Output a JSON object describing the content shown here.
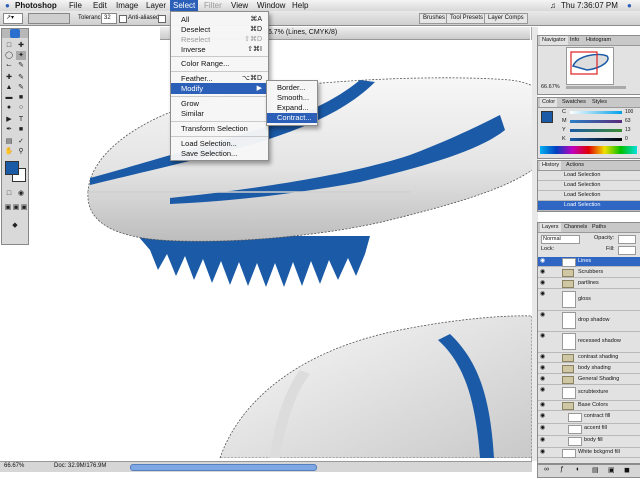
{
  "menubar": {
    "items": [
      "Photoshop",
      "File",
      "Edit",
      "Image",
      "Layer",
      "Select",
      "Filter",
      "View",
      "Window",
      "Help"
    ],
    "clock": "Thu 7:36:07 PM"
  },
  "options_bar": {
    "tolerance_label": "Tolerance:",
    "tolerance_value": "32",
    "anti_aliased_label": "Anti-aliased",
    "palette_tabs": [
      "Brushes",
      "Tool Presets",
      "Layer Comps"
    ]
  },
  "document": {
    "title": "@ 66.7% (Lines, CMYK/8)",
    "zoom": "66.67%",
    "doc_size": "Doc: 32.9M/176.9M"
  },
  "select_menu": {
    "items": [
      {
        "label": "All",
        "shortcut": "⌘A",
        "disabled": false
      },
      {
        "label": "Deselect",
        "shortcut": "⌘D",
        "disabled": false
      },
      {
        "label": "Reselect",
        "shortcut": "⇧⌘D",
        "disabled": true
      },
      {
        "label": "Inverse",
        "shortcut": "⇧⌘I",
        "disabled": false
      },
      {
        "label": "Color Range...",
        "shortcut": "",
        "disabled": false
      },
      {
        "label": "Feather...",
        "shortcut": "⌥⌘D",
        "disabled": false
      },
      {
        "label": "Modify",
        "shortcut": "▶",
        "disabled": false
      },
      {
        "label": "Grow",
        "shortcut": "",
        "disabled": false
      },
      {
        "label": "Similar",
        "shortcut": "",
        "disabled": false
      },
      {
        "label": "Transform Selection",
        "shortcut": "",
        "disabled": false
      },
      {
        "label": "Load Selection...",
        "shortcut": "",
        "disabled": false
      },
      {
        "label": "Save Selection...",
        "shortcut": "",
        "disabled": false
      }
    ],
    "modify_submenu": [
      "Border...",
      "Smooth...",
      "Expand...",
      "Contract..."
    ]
  },
  "navigator_panel": {
    "tabs": [
      "Navigator",
      "Info",
      "Histogram"
    ],
    "zoom": "66.67%"
  },
  "color_panel": {
    "tabs": [
      "Color",
      "Swatches",
      "Styles"
    ],
    "sliders": [
      {
        "label": "C",
        "value": "100"
      },
      {
        "label": "M",
        "value": "63"
      },
      {
        "label": "Y",
        "value": "13"
      },
      {
        "label": "K",
        "value": "0"
      }
    ],
    "foreground": "#1a5aa6"
  },
  "history_panel": {
    "tabs": [
      "History",
      "Actions"
    ],
    "items": [
      "Load Selection",
      "Load Selection",
      "Load Selection",
      "Load Selection"
    ]
  },
  "layers_panel": {
    "tabs": [
      "Layers",
      "Channels",
      "Paths"
    ],
    "blend_mode": "Normal",
    "opacity_label": "Opacity:",
    "lock_label": "Lock:",
    "fill_label": "Fill:",
    "layers": [
      {
        "name": "Lines",
        "type": "layer",
        "selected": true
      },
      {
        "name": "Scrubbers",
        "type": "group",
        "selected": false
      },
      {
        "name": "partlines",
        "type": "group",
        "selected": false
      },
      {
        "name": "gloss",
        "type": "layer",
        "selected": false
      },
      {
        "name": "drop shadow",
        "type": "layer",
        "selected": false
      },
      {
        "name": "recessed shadow",
        "type": "layer",
        "selected": false
      },
      {
        "name": "contrast shading",
        "type": "group",
        "selected": false
      },
      {
        "name": "body shading",
        "type": "group",
        "selected": false
      },
      {
        "name": "General Shading",
        "type": "group",
        "selected": false
      },
      {
        "name": "scrubtexture",
        "type": "layer",
        "selected": false
      },
      {
        "name": "Base Colors",
        "type": "group",
        "selected": false
      },
      {
        "name": "contract fill",
        "type": "layer",
        "selected": false
      },
      {
        "name": "accent fill",
        "type": "layer",
        "selected": false
      },
      {
        "name": "body fill",
        "type": "layer",
        "selected": false
      },
      {
        "name": "White bckgrnd fill",
        "type": "layer",
        "selected": false
      }
    ]
  },
  "colors": {
    "accent": "#1a5aa6",
    "menu_highlight": "#2b5fb8"
  }
}
